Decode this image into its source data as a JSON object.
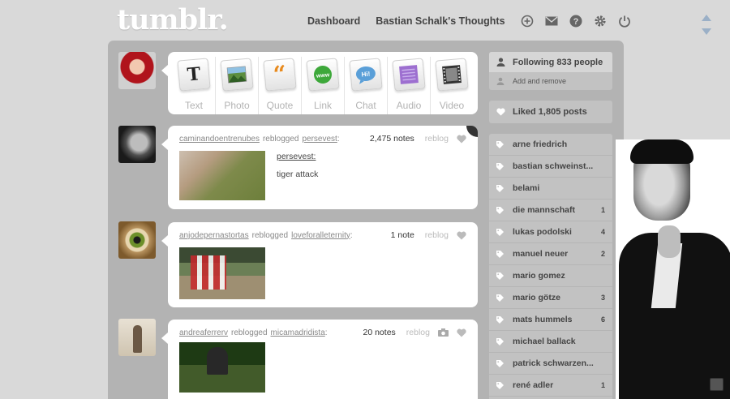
{
  "logo": "tumblr.",
  "topnav": {
    "dashboard": "Dashboard",
    "blog": "Bastian Schalk's Thoughts",
    "icons": [
      "plus-circle-icon",
      "mail-icon",
      "help-icon",
      "gear-icon",
      "power-icon"
    ]
  },
  "post_types": [
    "Text",
    "Photo",
    "Quote",
    "Link",
    "Chat",
    "Audio",
    "Video"
  ],
  "posts": [
    {
      "user": "caminandoentrenubes",
      "action": "reblogged",
      "source": "persevest",
      "notes": "2,475 notes",
      "reblog": "reblog",
      "text_title": "persevest:",
      "text_body": "tiger attack"
    },
    {
      "user": "anjodepernastortas",
      "action": "reblogged",
      "source": "loveforalleternity",
      "notes": "1 note",
      "reblog": "reblog"
    },
    {
      "user": "andreaferrerv",
      "action": "reblogged",
      "source": "micamadridista",
      "notes": "20 notes",
      "reblog": "reblog"
    }
  ],
  "sidebar": {
    "following": "Following 833 people",
    "add_remove": "Add and remove",
    "liked": "Liked 1,805 posts",
    "tags": [
      {
        "name": "arne friedrich",
        "count": ""
      },
      {
        "name": "bastian schweinst...",
        "count": ""
      },
      {
        "name": "belami",
        "count": ""
      },
      {
        "name": "die mannschaft",
        "count": "1"
      },
      {
        "name": "lukas podolski",
        "count": "4"
      },
      {
        "name": "manuel neuer",
        "count": "2"
      },
      {
        "name": "mario gomez",
        "count": ""
      },
      {
        "name": "mario götze",
        "count": "3"
      },
      {
        "name": "mats hummels",
        "count": "6"
      },
      {
        "name": "michael ballack",
        "count": ""
      },
      {
        "name": "patrick schwarzen...",
        "count": ""
      },
      {
        "name": "rené adler",
        "count": "1"
      }
    ]
  }
}
